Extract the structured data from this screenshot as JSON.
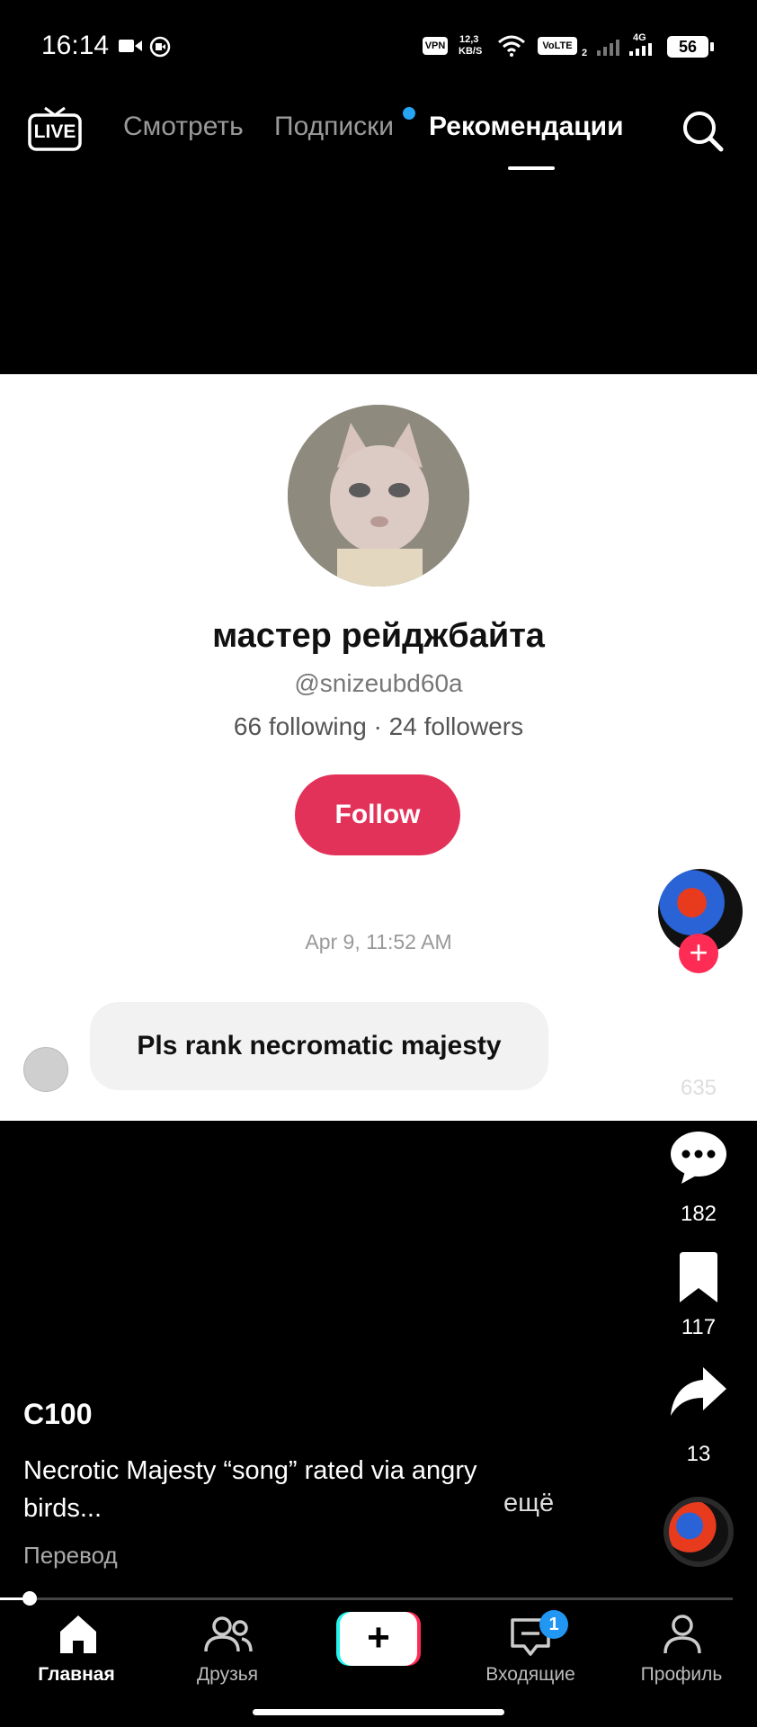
{
  "status_bar": {
    "time": "16:14",
    "speed_value": "12,3",
    "speed_unit": "KB/S",
    "vpn": "VPN",
    "volte": "VoLTE",
    "volte_sub": "2",
    "network": "4G",
    "battery": "56"
  },
  "top_nav": {
    "live": "LIVE",
    "tabs": [
      {
        "label": "Смотреть",
        "active": false
      },
      {
        "label": "Подписки",
        "active": false,
        "has_dot": true
      },
      {
        "label": "Рекомендации",
        "active": true
      }
    ],
    "search_icon": "search-icon"
  },
  "card": {
    "name": "мастер рейджбайта",
    "handle": "@snizeubd60a",
    "stats": "66 following · 24 followers",
    "follow_label": "Follow",
    "date": "Apr 9, 11:52 AM",
    "comment": "Pls rank necromatic majesty"
  },
  "rail": {
    "likes": "635",
    "comments": "182",
    "bookmarks": "117",
    "shares": "13"
  },
  "video": {
    "author": "C100",
    "description": "Necrotic Majesty “song” rated via angry birds...",
    "more": "ещё",
    "translate": "Перевод",
    "progress": 0.04
  },
  "bottom_nav": {
    "items": [
      {
        "label": "Главная",
        "icon": "home-icon",
        "active": true
      },
      {
        "label": "Друзья",
        "icon": "friends-icon",
        "active": false
      },
      {
        "label": "",
        "icon": "plus-icon",
        "active": false
      },
      {
        "label": "Входящие",
        "icon": "inbox-icon",
        "active": false,
        "badge": "1"
      },
      {
        "label": "Профиль",
        "icon": "profile-icon",
        "active": false
      }
    ]
  },
  "colors": {
    "follow": "#e2325a",
    "dot": "#27a5f5",
    "badge": "#2196f3",
    "plus_badge": "#fe2c55"
  }
}
